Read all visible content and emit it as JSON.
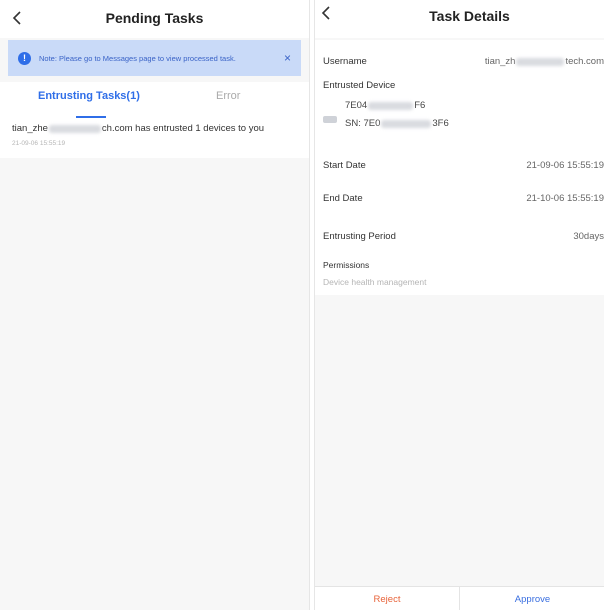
{
  "left": {
    "title": "Pending Tasks",
    "notice": {
      "text": "Note: Please go to Messages page to view processed task.",
      "close": "×"
    },
    "tabs": [
      "Entrusting Tasks(1)",
      "Error"
    ],
    "task": {
      "prefix": "tian_zhe",
      "suffix": "ch.com has entrusted 1 devices to you",
      "time": "21-09-06 15:55:19"
    }
  },
  "right": {
    "title": "Task Details",
    "username_label": "Username",
    "username_prefix": "tian_zh",
    "username_suffix": "tech.com",
    "device_label": "Entrusted Device",
    "device_name_prefix": "7E04",
    "device_name_suffix": "F6",
    "sn_prefix": "SN:  7E0",
    "sn_suffix": "3F6",
    "start_label": "Start Date",
    "start_value": "21-09-06 15:55:19",
    "end_label": "End Date",
    "end_value": "21-10-06 15:55:19",
    "period_label": "Entrusting Period",
    "period_value": "30days",
    "permissions_label": "Permissions",
    "permissions_value": "Device health management",
    "reject": "Reject",
    "approve": "Approve"
  },
  "colors": {
    "accent": "#2f6ee8",
    "notice_bg": "#c9daf8",
    "reject": "#e8643b",
    "approve": "#3a6fe0"
  },
  "icons": {
    "back": "chevron-left-icon",
    "info": "info-icon",
    "close": "close-icon",
    "device": "device-icon"
  }
}
